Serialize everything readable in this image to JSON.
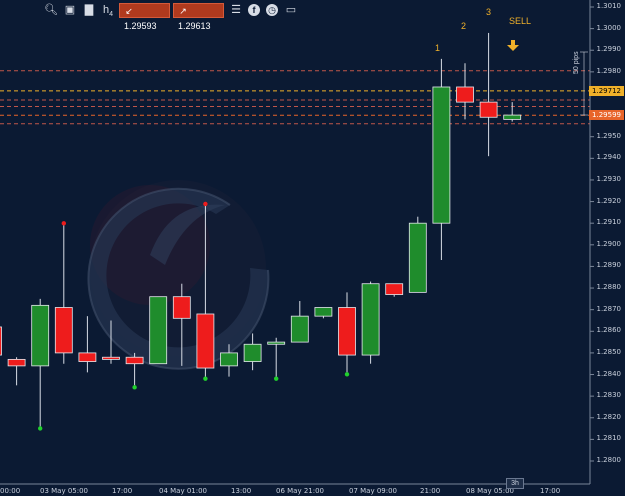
{
  "toolbar": {
    "icons": [
      "search-icon",
      "screenshot-icon",
      "bar-chart-icon",
      "period-icon",
      "candles-icon",
      "checklist-icon",
      "facebook-icon",
      "clock-icon",
      "trader-icon"
    ],
    "period_label": "4",
    "sell_price": "1.29593",
    "buy_price": "1.29613",
    "colors": {
      "price_box": "#b03a1e"
    }
  },
  "annotations": {
    "wave_1": "1",
    "wave_2": "2",
    "wave_3": "3",
    "signal": "SELL",
    "pips": "50 pips"
  },
  "price_axis": {
    "labels": [
      "1.3010",
      "1.3000",
      "1.2990",
      "1.2980",
      "1.2970",
      "1.2960",
      "1.2950",
      "1.2940",
      "1.2930",
      "1.2920",
      "1.2910",
      "1.2900",
      "1.2890",
      "1.2880",
      "1.2870",
      "1.2860",
      "1.2850",
      "1.2840",
      "1.2830",
      "1.2820",
      "1.2810",
      "1.2800"
    ],
    "tag_upper": "1.29712",
    "tag_current": "1.29599",
    "colors": {
      "upper": "#f0b12a",
      "current": "#e8652a"
    }
  },
  "time_axis": {
    "labels": [
      "00:00",
      "03 May 05:00",
      "17:00",
      "04 May 01:00",
      "13:00",
      "06 May 21:00",
      "07 May 09:00",
      "21:00",
      "08 May 05:00",
      "17:00"
    ],
    "timeframe": "3h"
  },
  "chart_data": {
    "type": "candlestick",
    "colors": {
      "bull": "#1f8c2c",
      "bear": "#ee1c1c"
    },
    "ylim": [
      1.2795,
      1.3012
    ],
    "candles": [
      {
        "o": 1.2862,
        "h": 1.2866,
        "l": 1.2848,
        "c": 1.2849
      },
      {
        "o": 1.2847,
        "h": 1.2848,
        "l": 1.2835,
        "c": 1.2844
      },
      {
        "o": 1.2844,
        "h": 1.2875,
        "l": 1.2816,
        "c": 1.2872
      },
      {
        "o": 1.2871,
        "h": 1.2909,
        "l": 1.2845,
        "c": 1.285
      },
      {
        "o": 1.285,
        "h": 1.2867,
        "l": 1.2841,
        "c": 1.2846
      },
      {
        "o": 1.2848,
        "h": 1.2865,
        "l": 1.2845,
        "c": 1.2847
      },
      {
        "o": 1.2848,
        "h": 1.285,
        "l": 1.2835,
        "c": 1.2845
      },
      {
        "o": 1.2845,
        "h": 1.2876,
        "l": 1.2845,
        "c": 1.2876
      },
      {
        "o": 1.2876,
        "h": 1.2882,
        "l": 1.2844,
        "c": 1.2866
      },
      {
        "o": 1.2868,
        "h": 1.2918,
        "l": 1.2839,
        "c": 1.2843
      },
      {
        "o": 1.2844,
        "h": 1.2854,
        "l": 1.2839,
        "c": 1.285
      },
      {
        "o": 1.2846,
        "h": 1.2859,
        "l": 1.2842,
        "c": 1.2854
      },
      {
        "o": 1.2854,
        "h": 1.2857,
        "l": 1.2839,
        "c": 1.2855
      },
      {
        "o": 1.2855,
        "h": 1.2874,
        "l": 1.2855,
        "c": 1.2867
      },
      {
        "o": 1.2867,
        "h": 1.287,
        "l": 1.2866,
        "c": 1.2871
      },
      {
        "o": 1.2871,
        "h": 1.2878,
        "l": 1.2841,
        "c": 1.2849
      },
      {
        "o": 1.2849,
        "h": 1.2883,
        "l": 1.2845,
        "c": 1.2882
      },
      {
        "o": 1.2882,
        "h": 1.2882,
        "l": 1.2876,
        "c": 1.2877
      },
      {
        "o": 1.2878,
        "h": 1.2913,
        "l": 1.2878,
        "c": 1.291
      },
      {
        "o": 1.291,
        "h": 1.2986,
        "l": 1.2893,
        "c": 1.2973
      },
      {
        "o": 1.2973,
        "h": 1.2984,
        "l": 1.2958,
        "c": 1.2966
      },
      {
        "o": 1.2966,
        "h": 1.2998,
        "l": 1.2941,
        "c": 1.2959
      },
      {
        "o": 1.2958,
        "h": 1.2966,
        "l": 1.2957,
        "c": 1.296
      }
    ],
    "fractal_markers": [
      {
        "candle": 3,
        "price": 1.2909,
        "color": "#ee1c1c"
      },
      {
        "candle": 9,
        "price": 1.2918,
        "color": "#ee1c1c"
      },
      {
        "candle": 2,
        "price": 1.2816,
        "color": "#1fd02c"
      },
      {
        "candle": 6,
        "price": 1.2835,
        "color": "#1fd02c"
      },
      {
        "candle": 9,
        "price": 1.2839,
        "color": "#1fd02c"
      },
      {
        "candle": 12,
        "price": 1.2839,
        "color": "#1fd02c"
      },
      {
        "candle": 15,
        "price": 1.2841,
        "color": "#1fd02c"
      }
    ],
    "levels": [
      {
        "price": 1.29805,
        "color": "#c0564a",
        "style": "dash"
      },
      {
        "price": 1.29712,
        "color": "#f0b12a",
        "style": "dash"
      },
      {
        "price": 1.2967,
        "color": "#c0564a",
        "style": "dash"
      },
      {
        "price": 1.2964,
        "color": "#c0564a",
        "style": "dash"
      },
      {
        "price": 1.29599,
        "color": "#e8652a",
        "style": "dash"
      },
      {
        "price": 1.2956,
        "color": "#c0564a",
        "style": "dash"
      }
    ]
  }
}
